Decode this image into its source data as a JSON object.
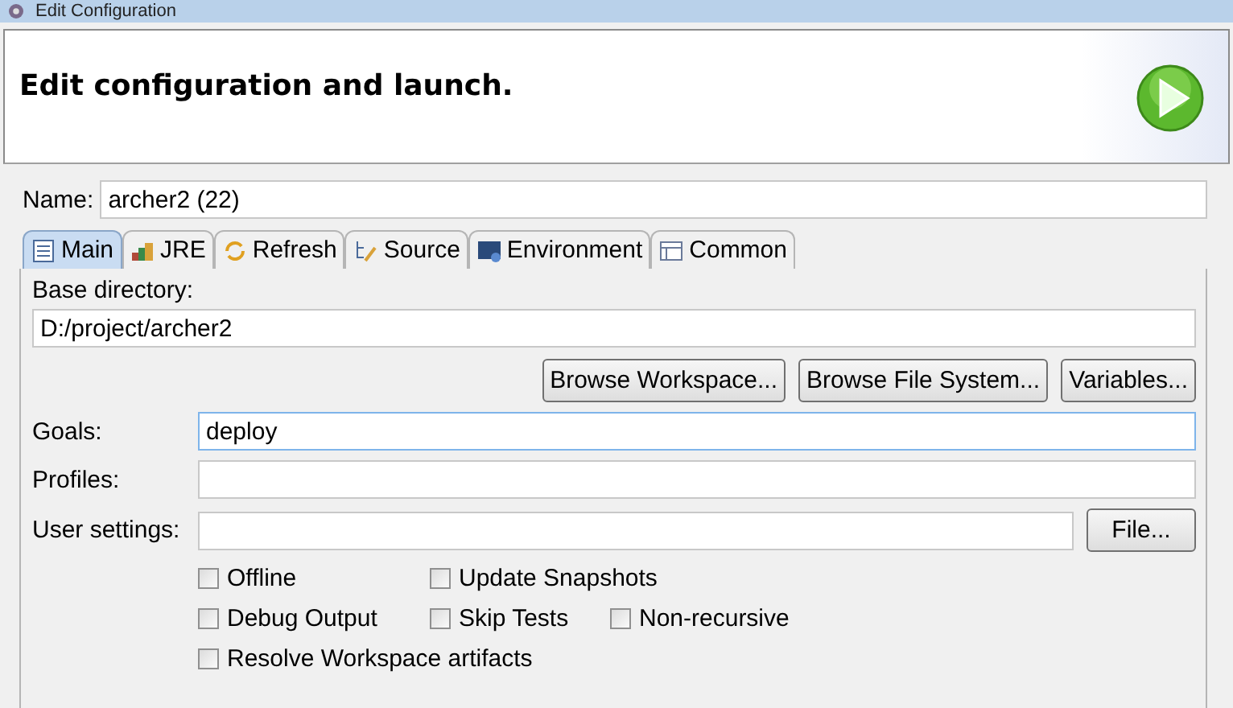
{
  "window": {
    "title": "Edit Configuration"
  },
  "header": {
    "title": "Edit configuration and launch."
  },
  "name": {
    "label": "Name:",
    "value": "archer2 (22)"
  },
  "tabs": [
    {
      "label": "Main",
      "selected": true
    },
    {
      "label": "JRE",
      "selected": false
    },
    {
      "label": "Refresh",
      "selected": false
    },
    {
      "label": "Source",
      "selected": false
    },
    {
      "label": "Environment",
      "selected": false
    },
    {
      "label": "Common",
      "selected": false
    }
  ],
  "base_directory": {
    "label": "Base directory:",
    "value": "D:/project/archer2",
    "buttons": [
      "Browse Workspace...",
      "Browse File System...",
      "Variables..."
    ]
  },
  "goals": {
    "label": "Goals:",
    "value": "deploy"
  },
  "profiles": {
    "label": "Profiles:"
  },
  "user_settings": {
    "label": "User settings:",
    "button": "File..."
  },
  "options": [
    [
      {
        "label": "Offline",
        "checked": false
      },
      {
        "label": "Update Snapshots",
        "checked": false
      }
    ],
    [
      {
        "label": "Debug Output",
        "checked": false
      },
      {
        "label": "Skip Tests",
        "checked": false
      },
      {
        "label": "Non-recursive",
        "checked": false
      }
    ],
    [
      {
        "label": "Resolve Workspace artifacts",
        "checked": false
      }
    ]
  ]
}
